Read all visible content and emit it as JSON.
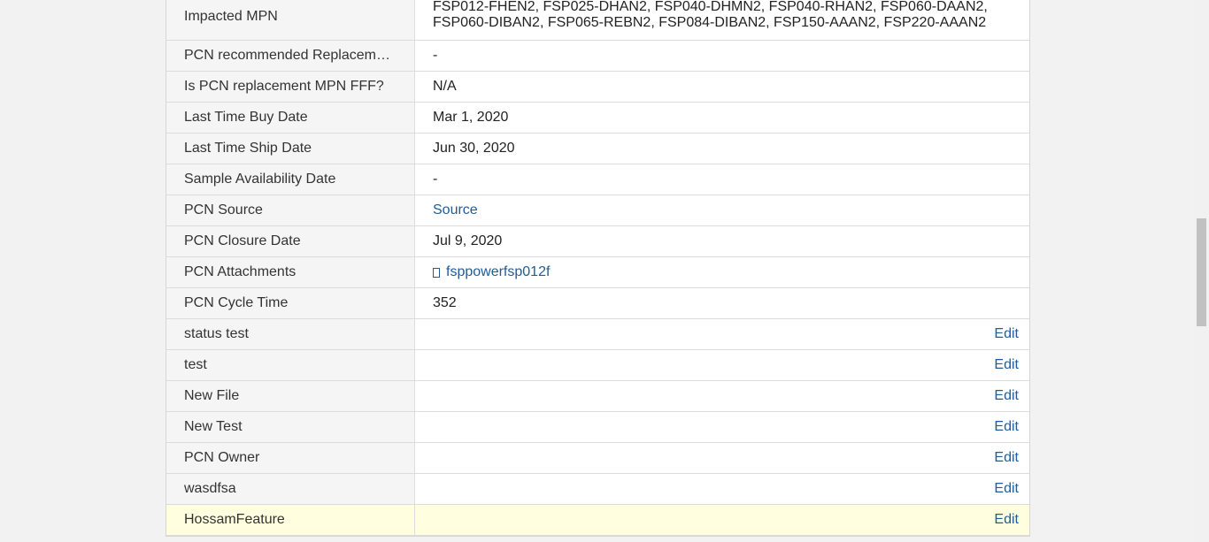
{
  "rows": [
    {
      "label": "Impacted MPN",
      "value_lines": [
        "FSP012-FHEN2, FSP025-DHAN2, FSP040-DHMN2, FSP040-RHAN2, FSP060-DAAN2,",
        "FSP060-DIBAN2, FSP065-REBN2, FSP084-DIBAN2, FSP150-AAAN2, FSP220-AAAN2"
      ]
    },
    {
      "label": "PCN recommended Replaceme…",
      "value": "-"
    },
    {
      "label": "Is PCN replacement MPN FFF?",
      "value": "N/A"
    },
    {
      "label": "Last Time Buy Date",
      "value": "Mar 1, 2020"
    },
    {
      "label": "Last Time Ship Date",
      "value": "Jun 30, 2020"
    },
    {
      "label": "Sample Availability Date",
      "value": "-"
    },
    {
      "label": "PCN Source",
      "link": "Source"
    },
    {
      "label": "PCN Closure Date",
      "value": "Jul 9, 2020"
    },
    {
      "label": "PCN Attachments",
      "attachment": "fsppowerfsp012f",
      "attachment_icon": "file-icon"
    },
    {
      "label": "PCN Cycle Time",
      "value": "352"
    },
    {
      "label": "status test",
      "action": "Edit"
    },
    {
      "label": "test",
      "action": "Edit"
    },
    {
      "label": "New File",
      "action": "Edit"
    },
    {
      "label": "New Test",
      "action": "Edit"
    },
    {
      "label": "PCN Owner",
      "action": "Edit"
    },
    {
      "label": "wasdfsa",
      "action": "Edit"
    },
    {
      "label": "HossamFeature",
      "action": "Edit",
      "highlighted": true
    }
  ],
  "colors": {
    "link": "#1f5c99",
    "highlight": "#ffffe0",
    "label_bg": "#f5f5f5"
  }
}
